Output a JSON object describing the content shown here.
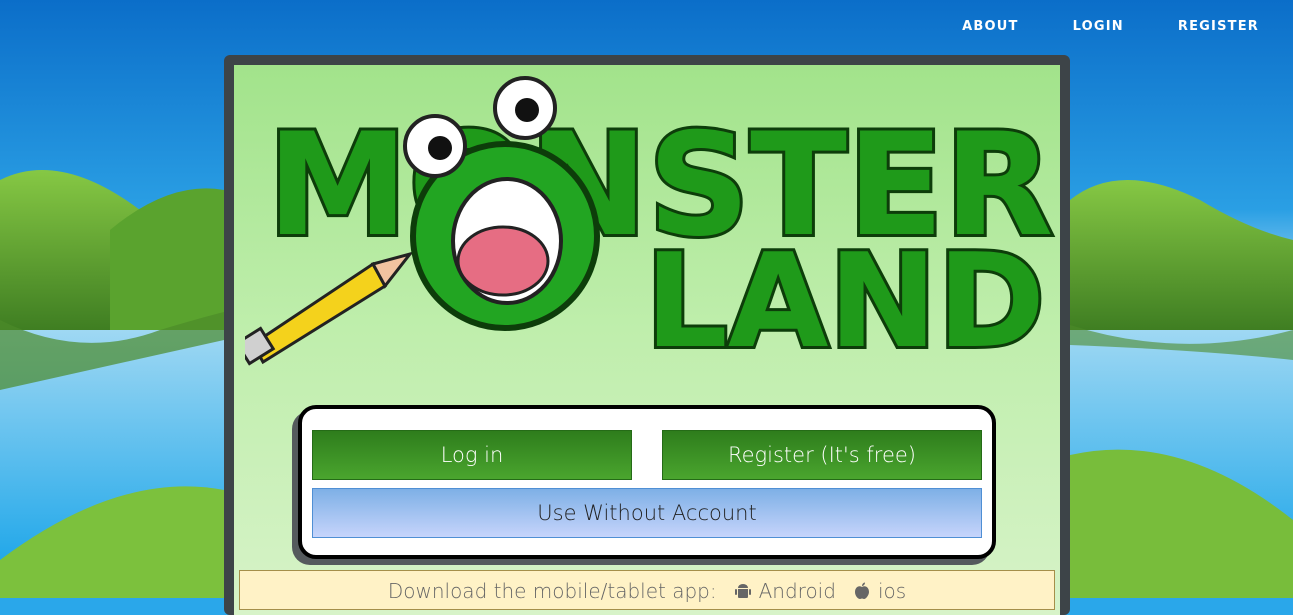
{
  "nav": {
    "items": [
      {
        "label": "ABOUT"
      },
      {
        "label": "LOGIN"
      },
      {
        "label": "REGISTER"
      }
    ]
  },
  "logo": {
    "line1": "MONSTER",
    "line2": "LAND"
  },
  "auth": {
    "login_label": "Log in",
    "register_label": "Register (It's free)",
    "guest_label": "Use Without Account"
  },
  "app_banner": {
    "text": "Download the mobile/tablet app:",
    "android_label": "Android",
    "ios_label": "ios"
  },
  "colors": {
    "sky": "#2aa7ea",
    "hill": "#6fb43a",
    "button_green": "#3a8e24",
    "button_blue": "#a8c4f2"
  }
}
